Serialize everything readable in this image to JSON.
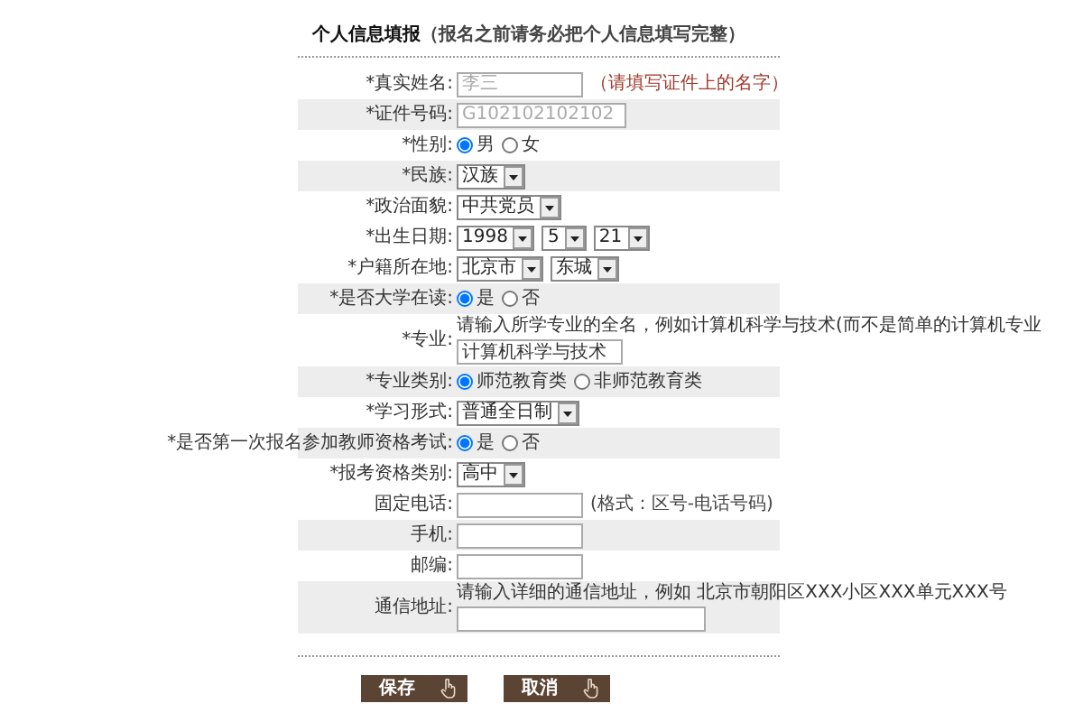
{
  "title": {
    "main": "个人信息填报",
    "note": "（报名之前请务必把个人信息填写完整）"
  },
  "rows": [
    {
      "kind": "text",
      "label": "*真实姓名:",
      "shaded": false,
      "placeholder": "李三",
      "hint": "（请填写证件上的名字）"
    },
    {
      "kind": "text",
      "label": "*证件号码:",
      "shaded": true,
      "placeholder": "G102102102102"
    },
    {
      "kind": "radio",
      "label": "*性别:",
      "shaded": false,
      "options": [
        {
          "label": "男",
          "selected": true
        },
        {
          "label": "女",
          "selected": false
        }
      ]
    },
    {
      "kind": "select",
      "label": "*民族:",
      "shaded": true,
      "selects": [
        {
          "value": "汉族"
        }
      ]
    },
    {
      "kind": "select",
      "label": "*政治面貌:",
      "shaded": false,
      "selects": [
        {
          "value": "中共党员"
        }
      ]
    },
    {
      "kind": "select",
      "label": "*出生日期:",
      "shaded": false,
      "selects": [
        {
          "value": "1998"
        },
        {
          "value": "5"
        },
        {
          "value": "21"
        }
      ]
    },
    {
      "kind": "select",
      "label": "*户籍所在地:",
      "shaded": false,
      "selects": [
        {
          "value": "北京市"
        },
        {
          "value": "东城"
        }
      ]
    },
    {
      "kind": "radio",
      "label": "*是否大学在读:",
      "shaded": true,
      "options": [
        {
          "label": "是",
          "selected": true
        },
        {
          "label": "否",
          "selected": false
        }
      ]
    },
    {
      "kind": "text",
      "label": "*专业:",
      "shaded": false,
      "note": "请输入所学专业的全名，例如计算机科学与技术(而不是简单的计算机专业",
      "value": "计算机科学与技术"
    },
    {
      "kind": "radio",
      "label": "*专业类别:",
      "shaded": true,
      "options": [
        {
          "label": "师范教育类",
          "selected": true
        },
        {
          "label": "非师范教育类",
          "selected": false
        }
      ]
    },
    {
      "kind": "select",
      "label": "*学习形式:",
      "shaded": false,
      "selects": [
        {
          "value": "普通全日制"
        }
      ]
    },
    {
      "kind": "radio",
      "label": "*是否第一次报名参加教师资格考试:",
      "shaded": true,
      "options": [
        {
          "label": "是",
          "selected": true
        },
        {
          "label": "否",
          "selected": false
        }
      ]
    },
    {
      "kind": "select",
      "label": "*报考资格类别:",
      "shaded": false,
      "selects": [
        {
          "value": "高中"
        }
      ]
    },
    {
      "kind": "text",
      "label": "固定电话:",
      "shaded": false,
      "hint": "(格式：区号-电话号码)"
    },
    {
      "kind": "text",
      "label": "手机:",
      "shaded": true
    },
    {
      "kind": "text",
      "label": "邮编:",
      "shaded": false
    },
    {
      "kind": "longtext",
      "label": "通信地址:",
      "shaded": true,
      "note": "请输入详细的通信地址，例如 北京市朝阳区XXX小区XXX单元XXX号"
    }
  ],
  "buttons": [
    {
      "label": "保存"
    },
    {
      "label": "取消"
    }
  ]
}
